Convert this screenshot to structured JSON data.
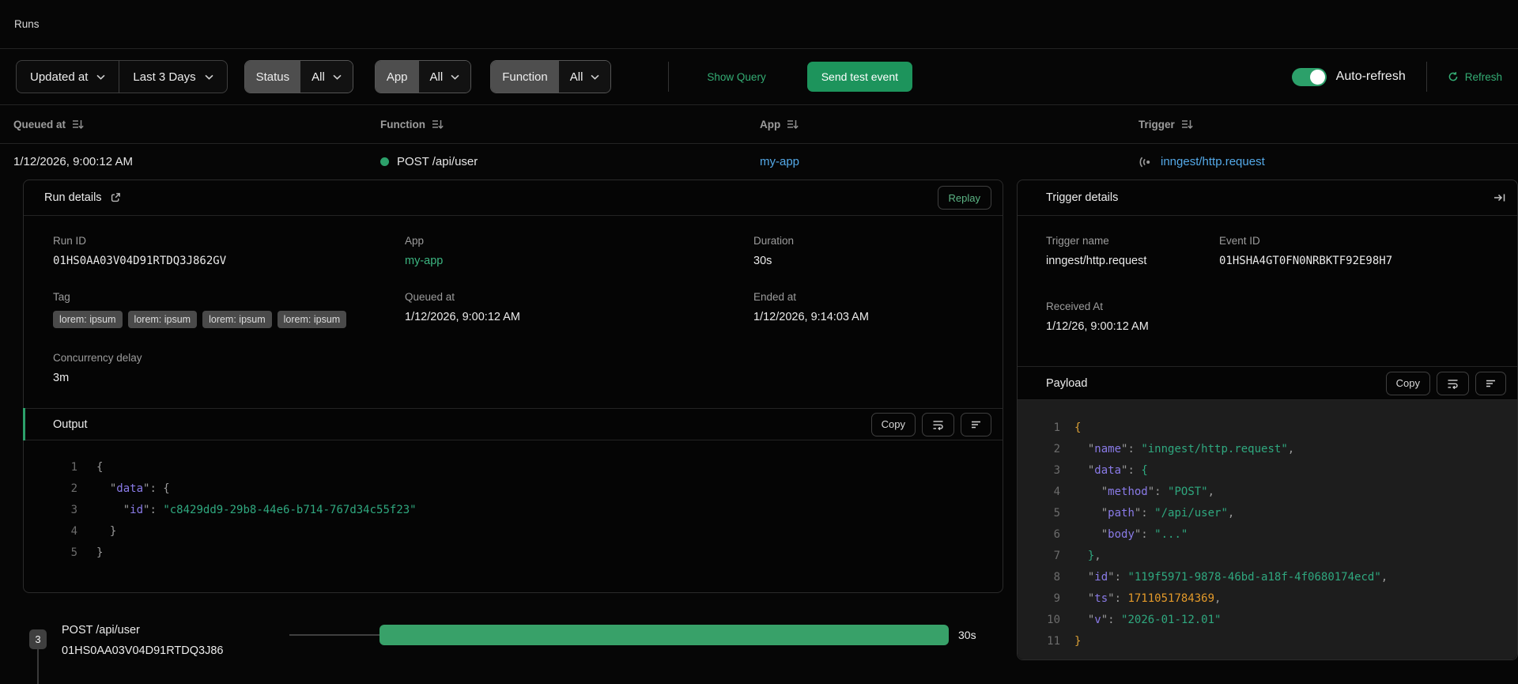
{
  "page": {
    "title": "Runs"
  },
  "colors": {
    "background": "#060606",
    "accent_green": "#2ca06a",
    "button_green": "#1d945c",
    "link_green": "#34ad74",
    "link_blue": "#54a9e8",
    "bar_green": "#38a169",
    "code_key": "#8a7be8",
    "code_string": "#2fa87f",
    "code_number": "#e39a2a",
    "payload_bg": "#1d1d1d"
  },
  "filters": {
    "sort_field": "Updated at",
    "time_range": "Last 3 Days",
    "status": {
      "label": "Status",
      "value": "All"
    },
    "app": {
      "label": "App",
      "value": "All"
    },
    "function": {
      "label": "Function",
      "value": "All"
    },
    "show_query": "Show Query",
    "send_test_event": "Send test event",
    "auto_refresh_label": "Auto-refresh",
    "auto_refresh_on": true,
    "refresh_label": "Refresh"
  },
  "table": {
    "headers": [
      "Queued at",
      "Function",
      "App",
      "Trigger"
    ],
    "row": {
      "queued_at": "1/12/2026, 9:00:12 AM",
      "function": "POST /api/user",
      "app": "my-app",
      "trigger": "inngest/http.request"
    }
  },
  "run_details": {
    "title": "Run details",
    "replay_label": "Replay",
    "run_id": {
      "label": "Run ID",
      "value": "01HS0AA03V04D91RTDQ3J862GV"
    },
    "app": {
      "label": "App",
      "value": "my-app"
    },
    "duration": {
      "label": "Duration",
      "value": "30s"
    },
    "tag": {
      "label": "Tag",
      "values": [
        "lorem: ipsum",
        "lorem: ipsum",
        "lorem: ipsum",
        "lorem: ipsum"
      ]
    },
    "queued_at": {
      "label": "Queued at",
      "value": "1/12/2026, 9:00:12 AM"
    },
    "ended_at": {
      "label": "Ended at",
      "value": "1/12/2026, 9:14:03 AM"
    },
    "concurrency_delay": {
      "label": "Concurrency delay",
      "value": "3m"
    },
    "output": {
      "title": "Output",
      "copy_label": "Copy",
      "code": [
        [
          [
            "pun",
            "{"
          ]
        ],
        [
          [
            "pun",
            "  \""
          ],
          [
            "key",
            "data"
          ],
          [
            "pun",
            "\": {"
          ]
        ],
        [
          [
            "pun",
            "    \""
          ],
          [
            "key",
            "id"
          ],
          [
            "pun",
            "\": "
          ],
          [
            "str",
            "\"c8429dd9-29b8-44e6-b714-767d34c55f23\""
          ]
        ],
        [
          [
            "pun",
            "  }"
          ]
        ],
        [
          [
            "pun",
            "}"
          ]
        ]
      ]
    }
  },
  "trigger_details": {
    "title": "Trigger details",
    "trigger_name": {
      "label": "Trigger name",
      "value": "inngest/http.request"
    },
    "event_id": {
      "label": "Event ID",
      "value": "01HSHA4GT0FN0NRBKTF92E98H7"
    },
    "received_at": {
      "label": "Received At",
      "value": "1/12/26, 9:00:12 AM"
    },
    "payload": {
      "title": "Payload",
      "copy_label": "Copy",
      "code": [
        [
          [
            "br1",
            "{"
          ]
        ],
        [
          [
            "pun",
            "  \""
          ],
          [
            "key",
            "name"
          ],
          [
            "pun",
            "\": "
          ],
          [
            "str",
            "\"inngest/http.request\""
          ],
          [
            "pun",
            ","
          ]
        ],
        [
          [
            "pun",
            "  \""
          ],
          [
            "key",
            "data"
          ],
          [
            "pun",
            "\": "
          ],
          [
            "br2",
            "{"
          ]
        ],
        [
          [
            "pun",
            "    \""
          ],
          [
            "key",
            "method"
          ],
          [
            "pun",
            "\": "
          ],
          [
            "str",
            "\"POST\""
          ],
          [
            "pun",
            ","
          ]
        ],
        [
          [
            "pun",
            "    \""
          ],
          [
            "key",
            "path"
          ],
          [
            "pun",
            "\": "
          ],
          [
            "str",
            "\"/api/user\""
          ],
          [
            "pun",
            ","
          ]
        ],
        [
          [
            "pun",
            "    \""
          ],
          [
            "key",
            "body"
          ],
          [
            "pun",
            "\": "
          ],
          [
            "str",
            "\"...\""
          ]
        ],
        [
          [
            "pun",
            "  "
          ],
          [
            "br2",
            "}"
          ],
          [
            "pun",
            ","
          ]
        ],
        [
          [
            "pun",
            "  \""
          ],
          [
            "key",
            "id"
          ],
          [
            "pun",
            "\": "
          ],
          [
            "str",
            "\"119f5971-9878-46bd-a18f-4f0680174ecd\""
          ],
          [
            "pun",
            ","
          ]
        ],
        [
          [
            "pun",
            "  \""
          ],
          [
            "key",
            "ts"
          ],
          [
            "pun",
            "\": "
          ],
          [
            "num",
            "1711051784369"
          ],
          [
            "pun",
            ","
          ]
        ],
        [
          [
            "pun",
            "  \""
          ],
          [
            "key",
            "v"
          ],
          [
            "pun",
            "\": "
          ],
          [
            "str",
            "\"2026-01-12.01\""
          ]
        ],
        [
          [
            "br1",
            "}"
          ]
        ]
      ]
    }
  },
  "timeline": {
    "count_badge": "3",
    "step_name": "POST /api/user",
    "step_id": "01HS0AA03V04D91RTDQ3J86",
    "duration": "30s"
  }
}
